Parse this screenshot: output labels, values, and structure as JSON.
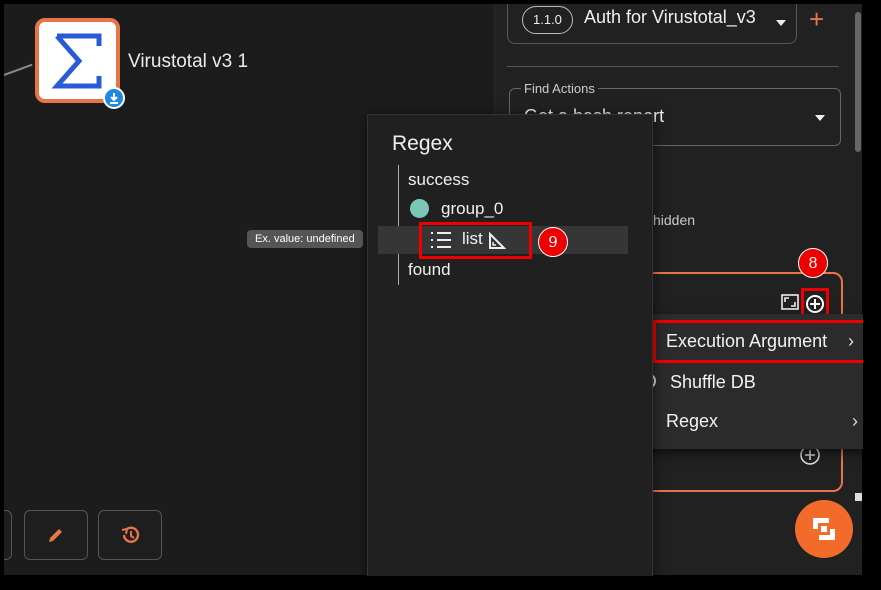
{
  "canvas": {
    "node_label": "Virustotal v3 1",
    "node_icon": "sigma-icon",
    "node_badge_icon": "download-icon",
    "tools": [
      {
        "name": "extra-tool-button",
        "icon": "partial-button"
      },
      {
        "name": "edit-button",
        "icon": "pencil-icon"
      },
      {
        "name": "history-button",
        "icon": "history-icon"
      }
    ],
    "tooltip": "Ex. value: undefined"
  },
  "panel": {
    "auth_version": "1.1.0",
    "auth_name": "Auth for Virustotal_v3",
    "auth_add": "+",
    "find_label": "Find Actions",
    "find_value": "Get a hash report",
    "hidden_text": "hidden"
  },
  "regex_popup": {
    "title": "Regex",
    "items": {
      "success": "success",
      "group": "group_0",
      "list": "list",
      "found": "found"
    }
  },
  "menu": {
    "items": [
      {
        "label": "Execution Argument",
        "chevron": "›"
      },
      {
        "label": "Shuffle DB"
      },
      {
        "label": "Regex",
        "chevron": "›"
      }
    ]
  },
  "steps": {
    "eight": "8",
    "nine": "9"
  },
  "colors": {
    "accent": "#e8754a",
    "highlight": "#e00000",
    "fab": "#f36b2b",
    "dot": "#7cc6b8"
  }
}
